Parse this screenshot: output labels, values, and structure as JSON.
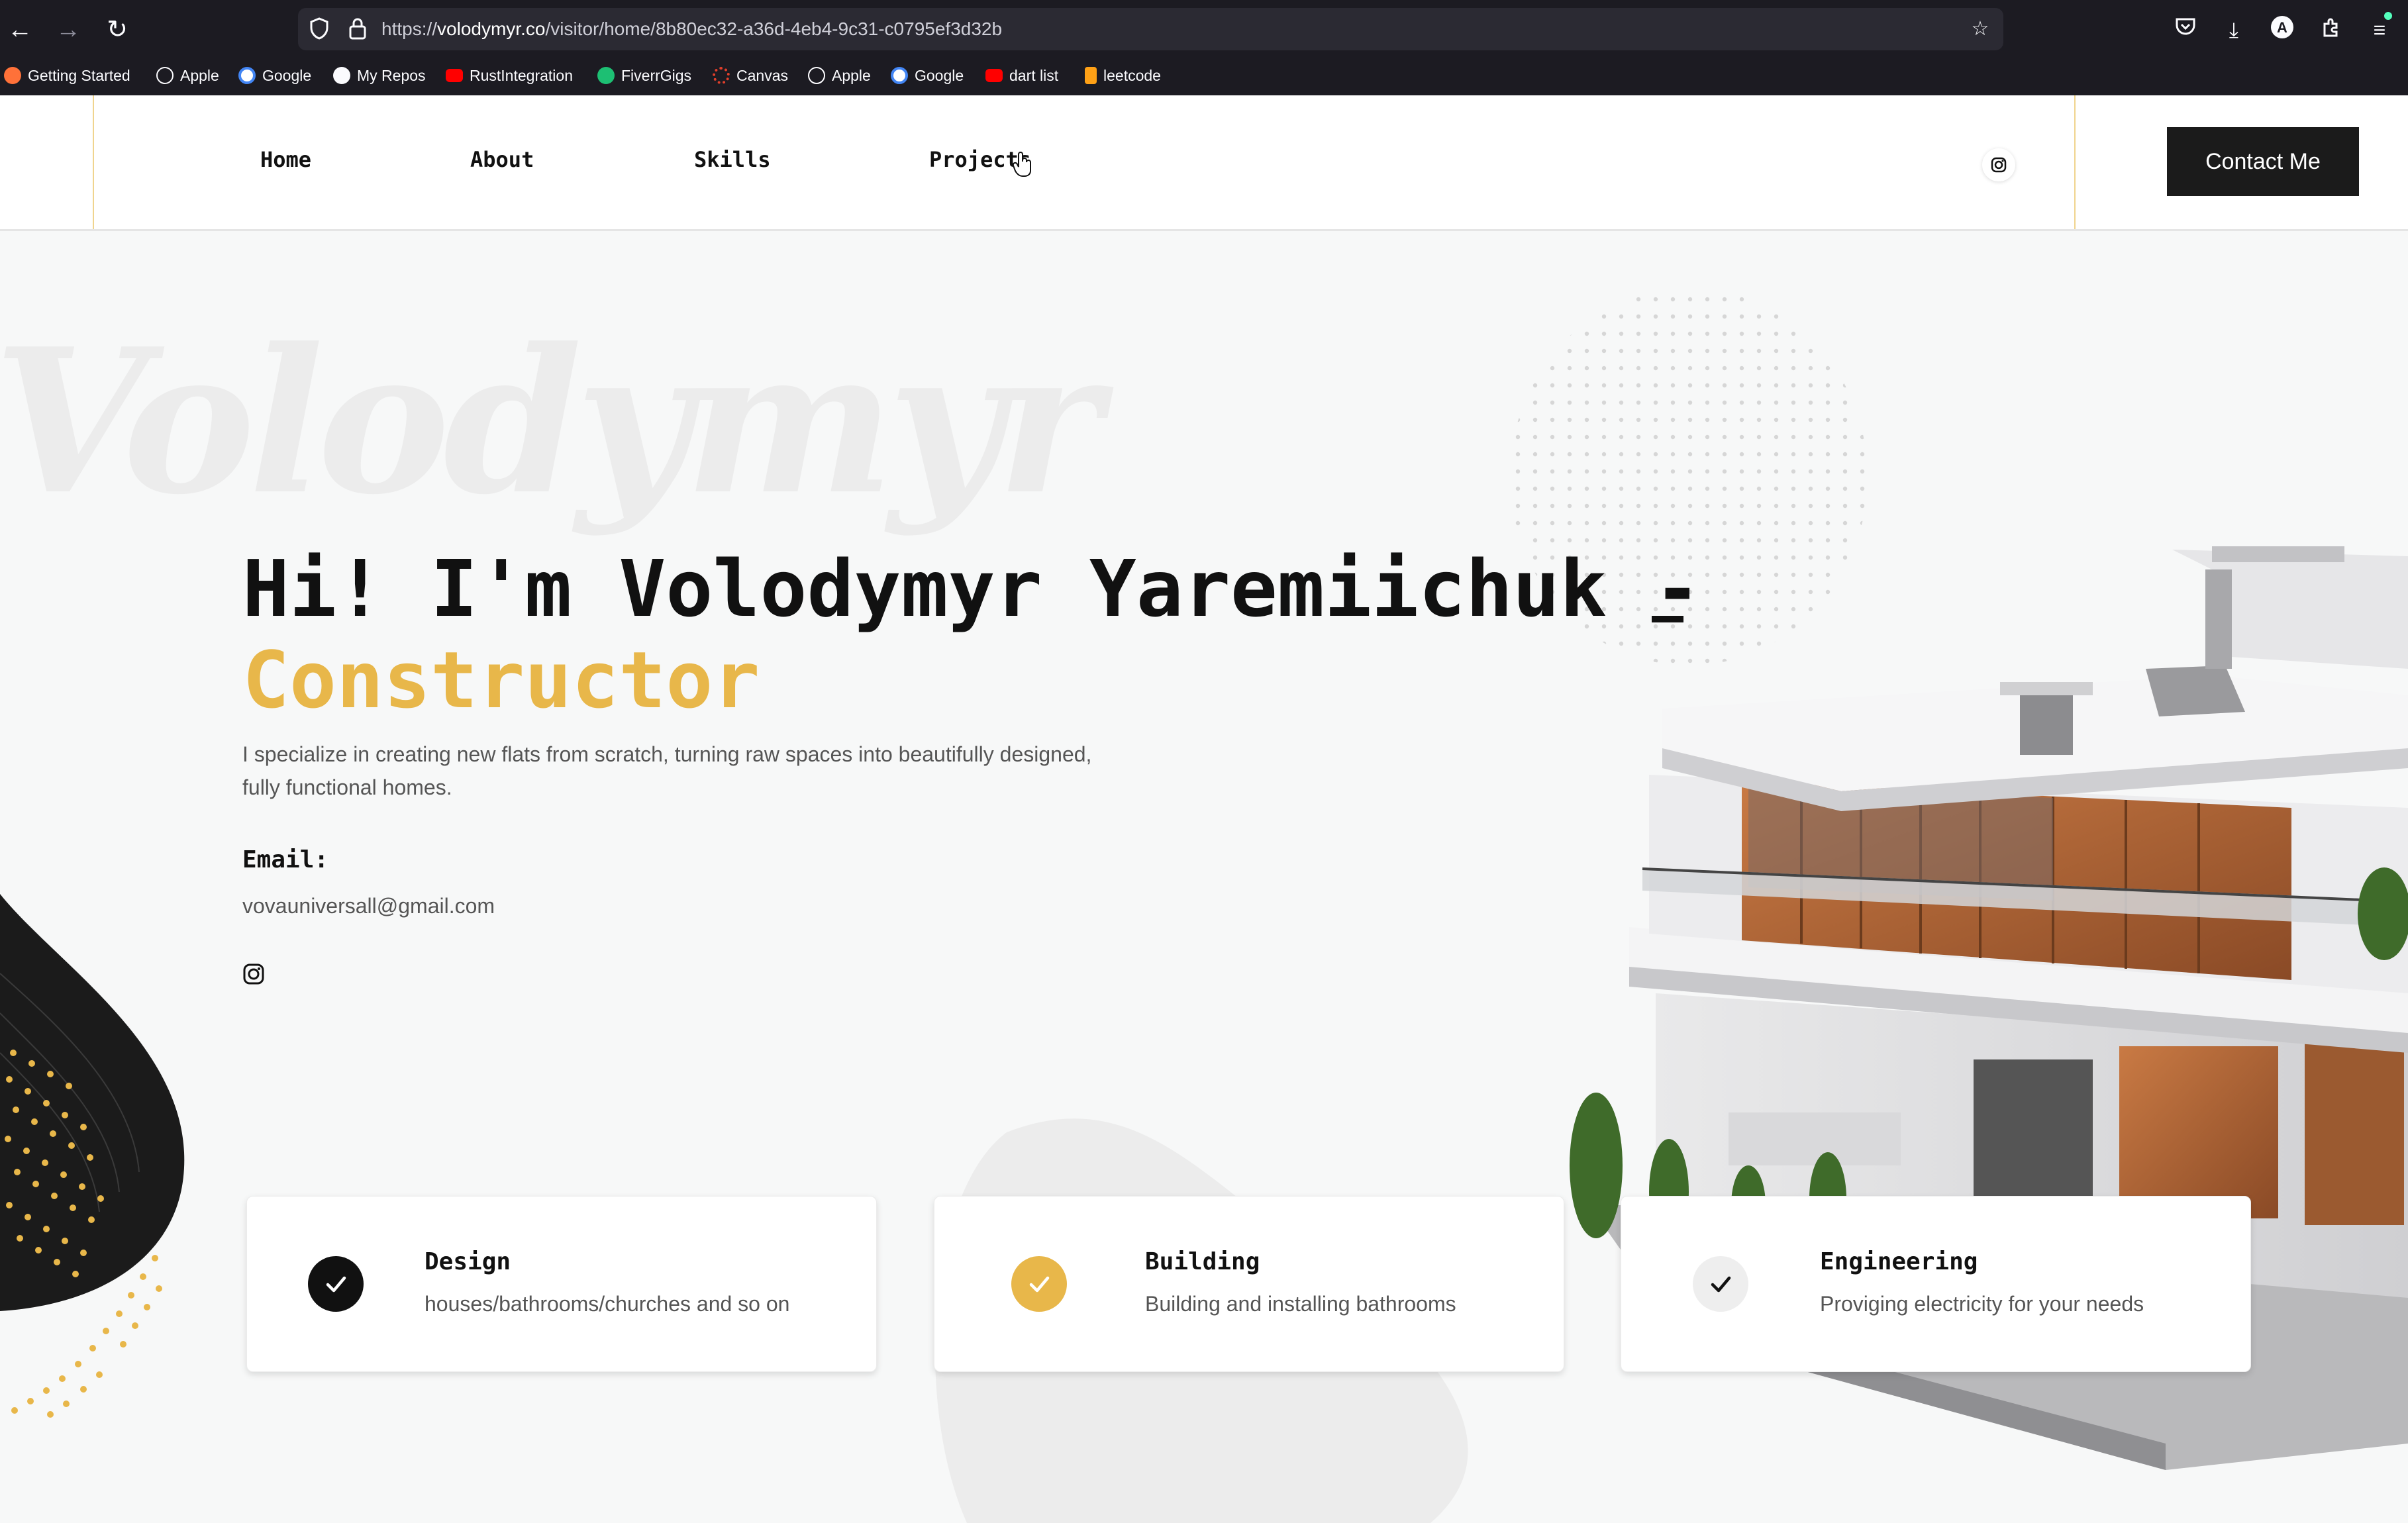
{
  "browser": {
    "url_prefix": "https://",
    "url_host": "volodymyr.co",
    "url_path": "/visitor/home/8b80ec32-a36d-4eb4-9c31-c0795ef3d32b",
    "bookmarks": [
      {
        "label": "Getting Started",
        "icon": "firefox-icon",
        "color": "#ff7139"
      },
      {
        "label": "Apple",
        "icon": "globe-icon",
        "color": "#fbfbfe"
      },
      {
        "label": "Google",
        "icon": "google-icon",
        "color": "#4285f4"
      },
      {
        "label": "My Repos",
        "icon": "github-icon",
        "color": "#fbfbfe"
      },
      {
        "label": "RustIntegration",
        "icon": "youtube-icon",
        "color": "#ff0000"
      },
      {
        "label": "FiverrGigs",
        "icon": "fiverr-icon",
        "color": "#1dbf73"
      },
      {
        "label": "Canvas",
        "icon": "canvas-icon",
        "color": "#e13f2b"
      },
      {
        "label": "Apple",
        "icon": "globe-icon",
        "color": "#fbfbfe"
      },
      {
        "label": "Google",
        "icon": "google-icon",
        "color": "#4285f4"
      },
      {
        "label": "dart list",
        "icon": "youtube-icon",
        "color": "#ff0000"
      },
      {
        "label": "leetcode",
        "icon": "leetcode-icon",
        "color": "#ffa116"
      }
    ]
  },
  "nav": {
    "items": [
      {
        "label": "Home",
        "active": true
      },
      {
        "label": "About",
        "active": false
      },
      {
        "label": "Skills",
        "active": false
      },
      {
        "label": "Projects",
        "active": false
      }
    ],
    "contact_label": "Contact Me"
  },
  "hero": {
    "watermark": "Volodymyr",
    "title": "Hi! I'm Volodymyr Yaremiichuk -",
    "role": "Constructor",
    "description": "I specialize in creating new flats from scratch, turning raw spaces into beautifully designed, fully functional homes.",
    "email_label": "Email:",
    "email": "vovauniversall@gmail.com"
  },
  "services": [
    {
      "title": "Design",
      "description": "houses/bathrooms/churches and so on",
      "check_bg": "#111111",
      "check_color": "#ffffff"
    },
    {
      "title": "Building",
      "description": "Building and installing bathrooms",
      "check_bg": "#e8b74a",
      "check_color": "#ffffff"
    },
    {
      "title": "Engineering",
      "description": "Proviging electricity for your needs",
      "check_bg": "#eeeeee",
      "check_color": "#111111"
    }
  ],
  "colors": {
    "accent": "#e8b74a",
    "dark": "#1b1b1b",
    "background": "#f7f8f8"
  }
}
